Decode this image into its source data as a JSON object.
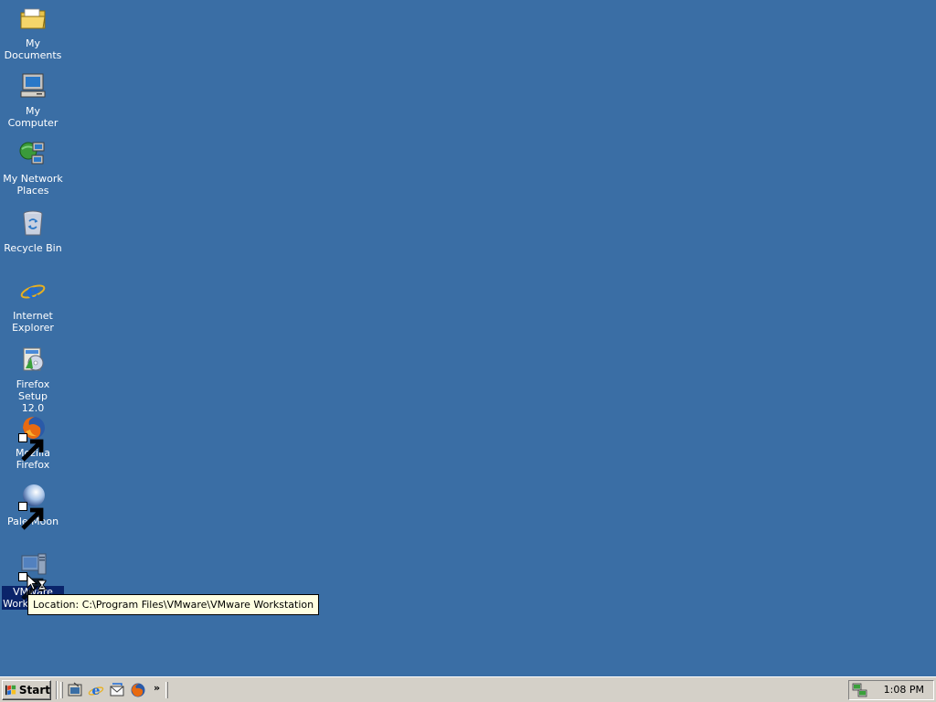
{
  "desktop": {
    "background": "#3a6ea5",
    "icons": [
      {
        "label": "My Documents",
        "icon": "my-documents-folder-icon"
      },
      {
        "label": "My Computer",
        "icon": "my-computer-icon"
      },
      {
        "label": "My Network\nPlaces",
        "icon": "network-places-icon"
      },
      {
        "label": "Recycle Bin",
        "icon": "recycle-bin-icon"
      },
      {
        "label": "Internet\nExplorer",
        "icon": "internet-explorer-icon"
      },
      {
        "label": "Firefox Setup\n12.0",
        "icon": "firefox-setup-icon"
      },
      {
        "label": "Mozilla Firefox",
        "icon": "firefox-icon",
        "shortcut": true
      },
      {
        "label": "Pale Moon",
        "icon": "pale-moon-icon",
        "shortcut": true
      },
      {
        "label": "VMware\nWorkstation",
        "icon": "vmware-workstation-icon",
        "shortcut": true,
        "selected": true
      }
    ]
  },
  "tooltip": {
    "text": "Location: C:\\Program Files\\VMware\\VMware Workstation"
  },
  "taskbar": {
    "start_label": "Start",
    "quick_launch": [
      {
        "name": "show-desktop-icon"
      },
      {
        "name": "internet-explorer-icon"
      },
      {
        "name": "outlook-express-icon"
      },
      {
        "name": "firefox-icon"
      }
    ],
    "chevron": "»",
    "clock": "1:08 PM",
    "tray_icon": "network-tray-icon"
  }
}
